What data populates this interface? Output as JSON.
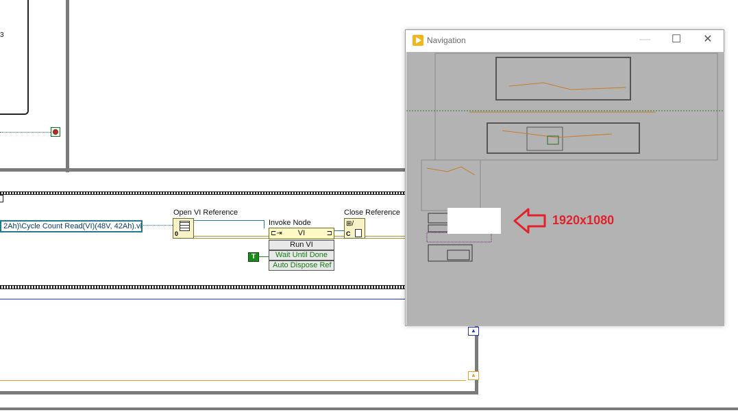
{
  "diagram": {
    "partial_constant_text": "3",
    "path_constant": "2Ah)\\Cycle Count Read(VI)(48V, 42Ah).vi",
    "open_vi_ref": {
      "label": "Open VI Reference",
      "terminal": "0"
    },
    "invoke_node": {
      "label": "Invoke Node",
      "class": "VI",
      "method": "Run VI",
      "params": [
        "Wait Until Done",
        "Auto Dispose Ref"
      ]
    },
    "close_ref": {
      "label": "Close Reference",
      "terminal": "C"
    },
    "true_constant": "T"
  },
  "nav_window": {
    "title": "Navigation",
    "minimize": "—",
    "maximize": "☐",
    "close": "✕"
  },
  "annotation": {
    "text": "1920x1080"
  },
  "colors": {
    "wire_path": "#1f7a8c",
    "wire_ref": "#2a7a8a",
    "wire_bool": "#1e8a1e",
    "wire_blue": "#2233cc",
    "wire_orange": "#e89a2a",
    "structure": "#7b7b7b",
    "annotation": "#e0222a"
  }
}
